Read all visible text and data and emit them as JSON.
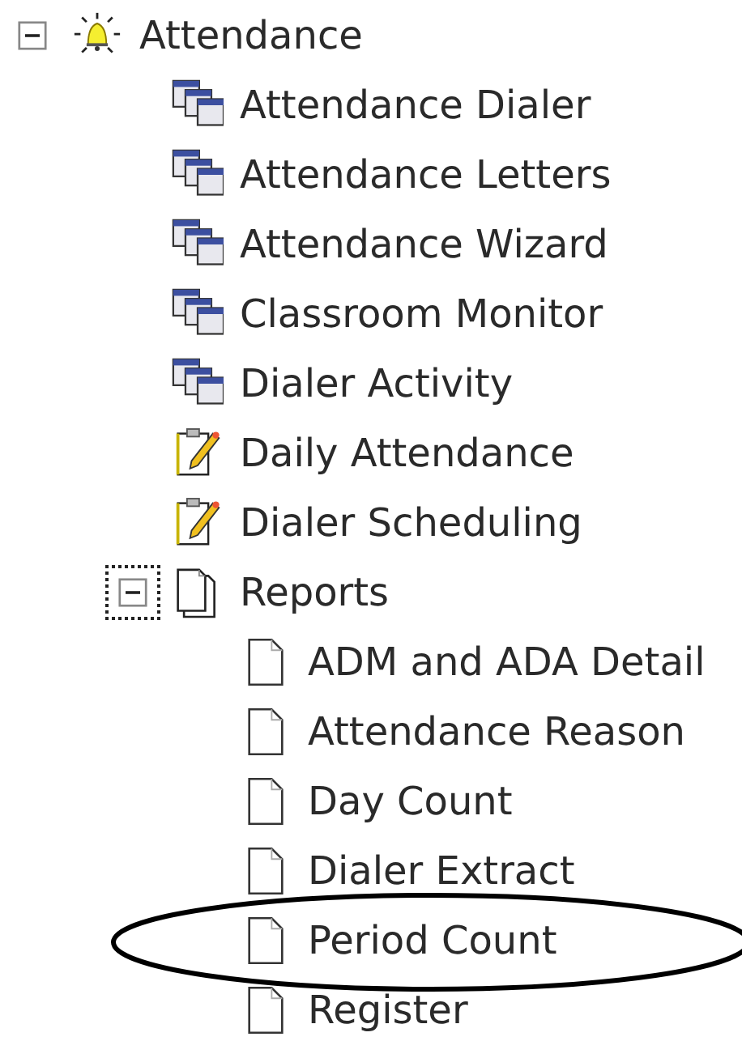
{
  "tree": [
    {
      "label": "Attendance",
      "kind": "bell",
      "expanded": true,
      "focused": false,
      "highlighted": false,
      "children": [
        {
          "label": "Attendance Dialer",
          "kind": "windows",
          "highlighted": false
        },
        {
          "label": "Attendance Letters",
          "kind": "windows",
          "highlighted": false
        },
        {
          "label": "Attendance Wizard",
          "kind": "windows",
          "highlighted": false
        },
        {
          "label": "Classroom Monitor",
          "kind": "windows",
          "highlighted": false
        },
        {
          "label": "Dialer Activity",
          "kind": "windows",
          "highlighted": false
        },
        {
          "label": "Daily Attendance",
          "kind": "notepad",
          "highlighted": false
        },
        {
          "label": "Dialer Scheduling",
          "kind": "notepad",
          "highlighted": false
        },
        {
          "label": "Reports",
          "kind": "stack",
          "expanded": true,
          "focused": true,
          "highlighted": false,
          "children": [
            {
              "label": "ADM and ADA Detail",
              "kind": "document",
              "highlighted": false
            },
            {
              "label": "Attendance Reason",
              "kind": "document",
              "highlighted": false
            },
            {
              "label": "Day Count",
              "kind": "document",
              "highlighted": false
            },
            {
              "label": "Dialer Extract",
              "kind": "document",
              "highlighted": false
            },
            {
              "label": "Period Count",
              "kind": "document",
              "highlighted": true
            },
            {
              "label": "Register",
              "kind": "document",
              "highlighted": false
            }
          ]
        }
      ]
    }
  ]
}
